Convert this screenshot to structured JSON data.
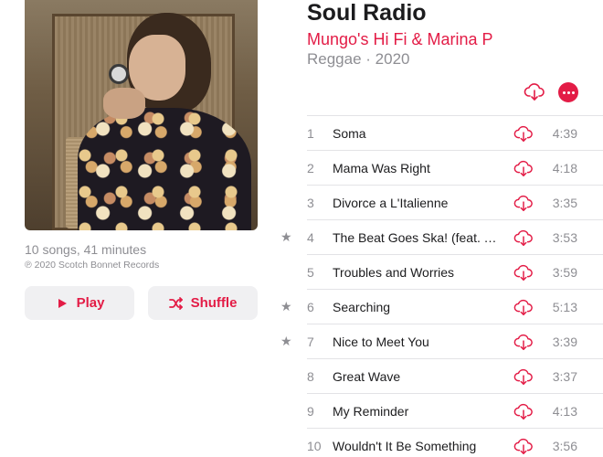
{
  "album": {
    "title": "Soul Radio",
    "artist": "Mungo's Hi Fi & Marina P",
    "genre_year": "Reggae · 2020",
    "summary": "10 songs, 41 minutes",
    "copyright": "℗ 2020 Scotch Bonnet Records"
  },
  "actions": {
    "play_label": "Play",
    "shuffle_label": "Shuffle"
  },
  "colors": {
    "accent": "#e31c46",
    "secondary_text": "#8e8e93",
    "button_bg": "#f0f0f2"
  },
  "tracks": [
    {
      "num": "1",
      "title": "Soma",
      "duration": "4:39",
      "starred": false
    },
    {
      "num": "2",
      "title": "Mama Was Right",
      "duration": "4:18",
      "starred": false
    },
    {
      "num": "3",
      "title": "Divorce a L'Italienne",
      "duration": "3:35",
      "starred": false
    },
    {
      "num": "4",
      "title": "The Beat Goes Ska! (feat. Ti...",
      "duration": "3:53",
      "starred": true
    },
    {
      "num": "5",
      "title": "Troubles and Worries",
      "duration": "3:59",
      "starred": false
    },
    {
      "num": "6",
      "title": "Searching",
      "duration": "5:13",
      "starred": true
    },
    {
      "num": "7",
      "title": "Nice to Meet You",
      "duration": "3:39",
      "starred": true
    },
    {
      "num": "8",
      "title": "Great Wave",
      "duration": "3:37",
      "starred": false
    },
    {
      "num": "9",
      "title": "My Reminder",
      "duration": "4:13",
      "starred": false
    },
    {
      "num": "10",
      "title": "Wouldn't It Be Something",
      "duration": "3:56",
      "starred": false
    }
  ],
  "icons": {
    "star": "★",
    "download": "cloud-download-icon",
    "more": "more-icon",
    "play": "play-icon",
    "shuffle": "shuffle-icon"
  }
}
